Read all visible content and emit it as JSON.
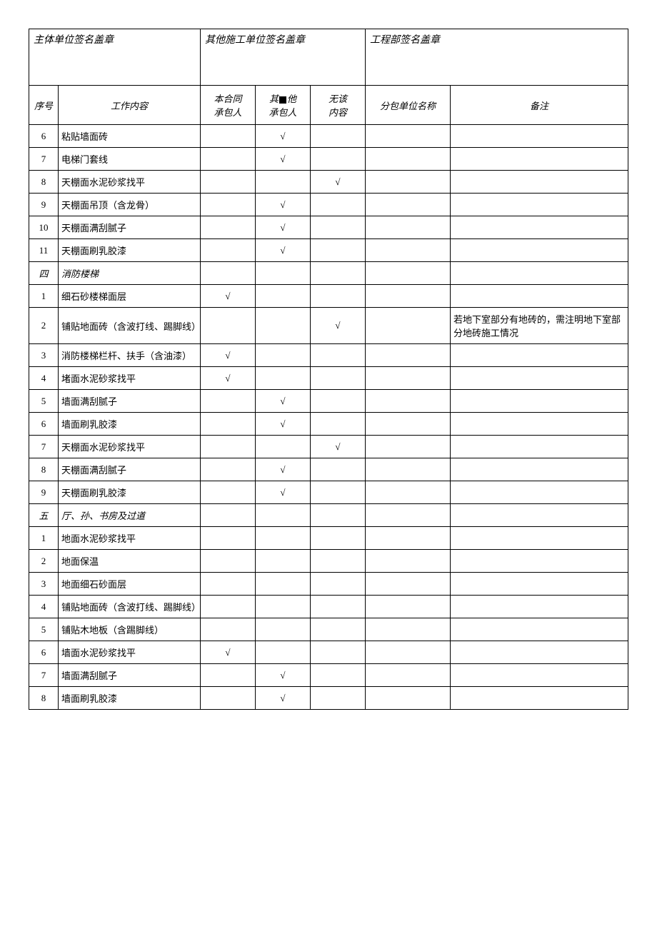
{
  "signatures": {
    "main_unit": "主体单位签名盖章",
    "other_unit": "其他施工单位签名盖章",
    "engineering": "工程部签名盖章"
  },
  "headers": {
    "seq": "序号",
    "work": "工作内容",
    "contract": "本合同\n承包人",
    "other_pre": "其",
    "other_post": "他\n承包人",
    "none": "无该\n内容",
    "sub": "分包单位名称",
    "remark": "备注"
  },
  "checkmark": "√",
  "rows": [
    {
      "seq": "6",
      "work": "粘贴墙面砖",
      "contract": "",
      "other": "√",
      "none": "",
      "sub": "",
      "remark": ""
    },
    {
      "seq": "7",
      "work": "电梯门套线",
      "contract": "",
      "other": "√",
      "none": "",
      "sub": "",
      "remark": ""
    },
    {
      "seq": "8",
      "work": "天棚面水泥砂浆找平",
      "contract": "",
      "other": "",
      "none": "√",
      "sub": "",
      "remark": ""
    },
    {
      "seq": "9",
      "work": "天棚面吊顶（含龙骨）",
      "contract": "",
      "other": "√",
      "none": "",
      "sub": "",
      "remark": ""
    },
    {
      "seq": "10",
      "work": "天棚面满刮腻子",
      "contract": "",
      "other": "√",
      "none": "",
      "sub": "",
      "remark": ""
    },
    {
      "seq": "11",
      "work": "天棚面刷乳胶漆",
      "contract": "",
      "other": "√",
      "none": "",
      "sub": "",
      "remark": ""
    },
    {
      "seq": "四",
      "work": "消防楼梯",
      "contract": "",
      "other": "",
      "none": "",
      "sub": "",
      "remark": "",
      "section": true
    },
    {
      "seq": "1",
      "work": "细石砂楼梯面层",
      "contract": "√",
      "other": "",
      "none": "",
      "sub": "",
      "remark": ""
    },
    {
      "seq": "2",
      "work": "铺贴地面砖（含波打线、踢脚线）",
      "contract": "",
      "other": "",
      "none": "√",
      "sub": "",
      "remark": "若地下室部分有地砖的，需注明地下室部分地砖施工情况"
    },
    {
      "seq": "3",
      "work": "消防楼梯栏杆、扶手（含油漆）",
      "contract": "√",
      "other": "",
      "none": "",
      "sub": "",
      "remark": ""
    },
    {
      "seq": "4",
      "work": "堵面水泥砂浆找平",
      "contract": "√",
      "other": "",
      "none": "",
      "sub": "",
      "remark": ""
    },
    {
      "seq": "5",
      "work": "墙面满刮腻子",
      "contract": "",
      "other": "√",
      "none": "",
      "sub": "",
      "remark": ""
    },
    {
      "seq": "6",
      "work": "墙面刷乳胶漆",
      "contract": "",
      "other": "√",
      "none": "",
      "sub": "",
      "remark": ""
    },
    {
      "seq": "7",
      "work": "天棚面水泥砂浆找平",
      "contract": "",
      "other": "",
      "none": "√",
      "sub": "",
      "remark": ""
    },
    {
      "seq": "8",
      "work": "天棚面满刮腻子",
      "contract": "",
      "other": "√",
      "none": "",
      "sub": "",
      "remark": ""
    },
    {
      "seq": "9",
      "work": "天棚面刷乳胶漆",
      "contract": "",
      "other": "√",
      "none": "",
      "sub": "",
      "remark": ""
    },
    {
      "seq": "五",
      "work": "厅、孙、书房及过道",
      "contract": "",
      "other": "",
      "none": "",
      "sub": "",
      "remark": "",
      "section": true
    },
    {
      "seq": "1",
      "work": "地面水泥砂浆找平",
      "contract": "",
      "other": "",
      "none": "",
      "sub": "",
      "remark": ""
    },
    {
      "seq": "2",
      "work": "地面保温",
      "contract": "",
      "other": "",
      "none": "",
      "sub": "",
      "remark": ""
    },
    {
      "seq": "3",
      "work": "地面细石砂面层",
      "contract": "",
      "other": "",
      "none": "",
      "sub": "",
      "remark": ""
    },
    {
      "seq": "4",
      "work": "铺贴地面砖（含波打线、踢脚线）",
      "contract": "",
      "other": "",
      "none": "",
      "sub": "",
      "remark": ""
    },
    {
      "seq": "5",
      "work": "铺贴木地板（含踢脚线）",
      "contract": "",
      "other": "",
      "none": "",
      "sub": "",
      "remark": ""
    },
    {
      "seq": "6",
      "work": "墙面水泥砂浆找平",
      "contract": "√",
      "other": "",
      "none": "",
      "sub": "",
      "remark": ""
    },
    {
      "seq": "7",
      "work": "墙面满刮腻子",
      "contract": "",
      "other": "√",
      "none": "",
      "sub": "",
      "remark": ""
    },
    {
      "seq": "8",
      "work": "墙面刷乳胶漆",
      "contract": "",
      "other": "√",
      "none": "",
      "sub": "",
      "remark": ""
    }
  ]
}
